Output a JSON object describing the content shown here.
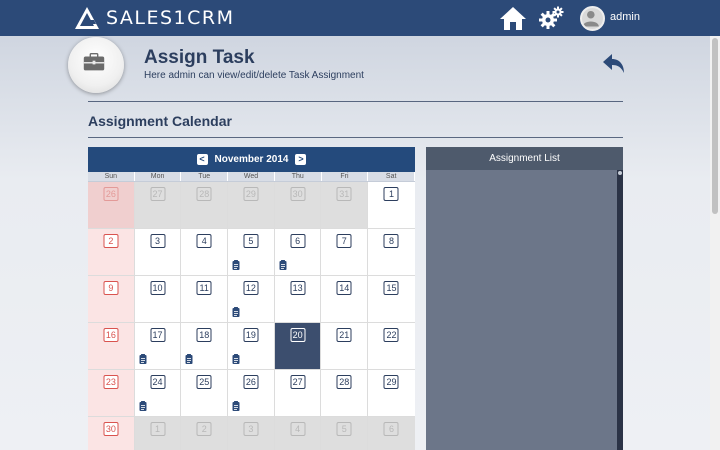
{
  "app": {
    "logo_text": "SALES1CRM",
    "username": "admin"
  },
  "icons": {
    "home": "home-icon",
    "settings": "gears-icon",
    "back": "back-arrow-icon",
    "task": "clipboard-icon",
    "page": "briefcase-icon"
  },
  "header": {
    "title": "Assign Task",
    "subtitle": "Here admin can view/edit/delete Task Assignment"
  },
  "section": {
    "title": "Assignment Calendar"
  },
  "calendar": {
    "month_label": "November 2014",
    "prev": "<",
    "next": ">",
    "weekdays": [
      "Sun",
      "Mon",
      "Tue",
      "Wed",
      "Thu",
      "Fri",
      "Sat"
    ],
    "today": 20,
    "weeks": [
      [
        {
          "d": "26",
          "o": true
        },
        {
          "d": "27",
          "o": true
        },
        {
          "d": "28",
          "o": true
        },
        {
          "d": "29",
          "o": true
        },
        {
          "d": "30",
          "o": true
        },
        {
          "d": "31",
          "o": true
        },
        {
          "d": "1"
        }
      ],
      [
        {
          "d": "2"
        },
        {
          "d": "3"
        },
        {
          "d": "4"
        },
        {
          "d": "5",
          "task": true
        },
        {
          "d": "6",
          "task": true
        },
        {
          "d": "7"
        },
        {
          "d": "8"
        }
      ],
      [
        {
          "d": "9"
        },
        {
          "d": "10"
        },
        {
          "d": "11"
        },
        {
          "d": "12",
          "task": true
        },
        {
          "d": "13"
        },
        {
          "d": "14"
        },
        {
          "d": "15"
        }
      ],
      [
        {
          "d": "16"
        },
        {
          "d": "17",
          "task": true
        },
        {
          "d": "18",
          "task": true
        },
        {
          "d": "19",
          "task": true
        },
        {
          "d": "20",
          "today": true
        },
        {
          "d": "21"
        },
        {
          "d": "22"
        }
      ],
      [
        {
          "d": "23"
        },
        {
          "d": "24",
          "task": true
        },
        {
          "d": "25"
        },
        {
          "d": "26",
          "task": true
        },
        {
          "d": "27"
        },
        {
          "d": "28"
        },
        {
          "d": "29"
        }
      ],
      [
        {
          "d": "30"
        },
        {
          "d": "1",
          "o": true
        },
        {
          "d": "2",
          "o": true
        },
        {
          "d": "3",
          "o": true
        },
        {
          "d": "4",
          "o": true
        },
        {
          "d": "5",
          "o": true
        },
        {
          "d": "6",
          "o": true
        }
      ]
    ]
  },
  "assignment_list": {
    "title": "Assignment List"
  },
  "colors": {
    "topbar": "#2c4a78",
    "accent": "#244a7c",
    "title": "#2c3e5e",
    "sunday": "#d9534f"
  }
}
